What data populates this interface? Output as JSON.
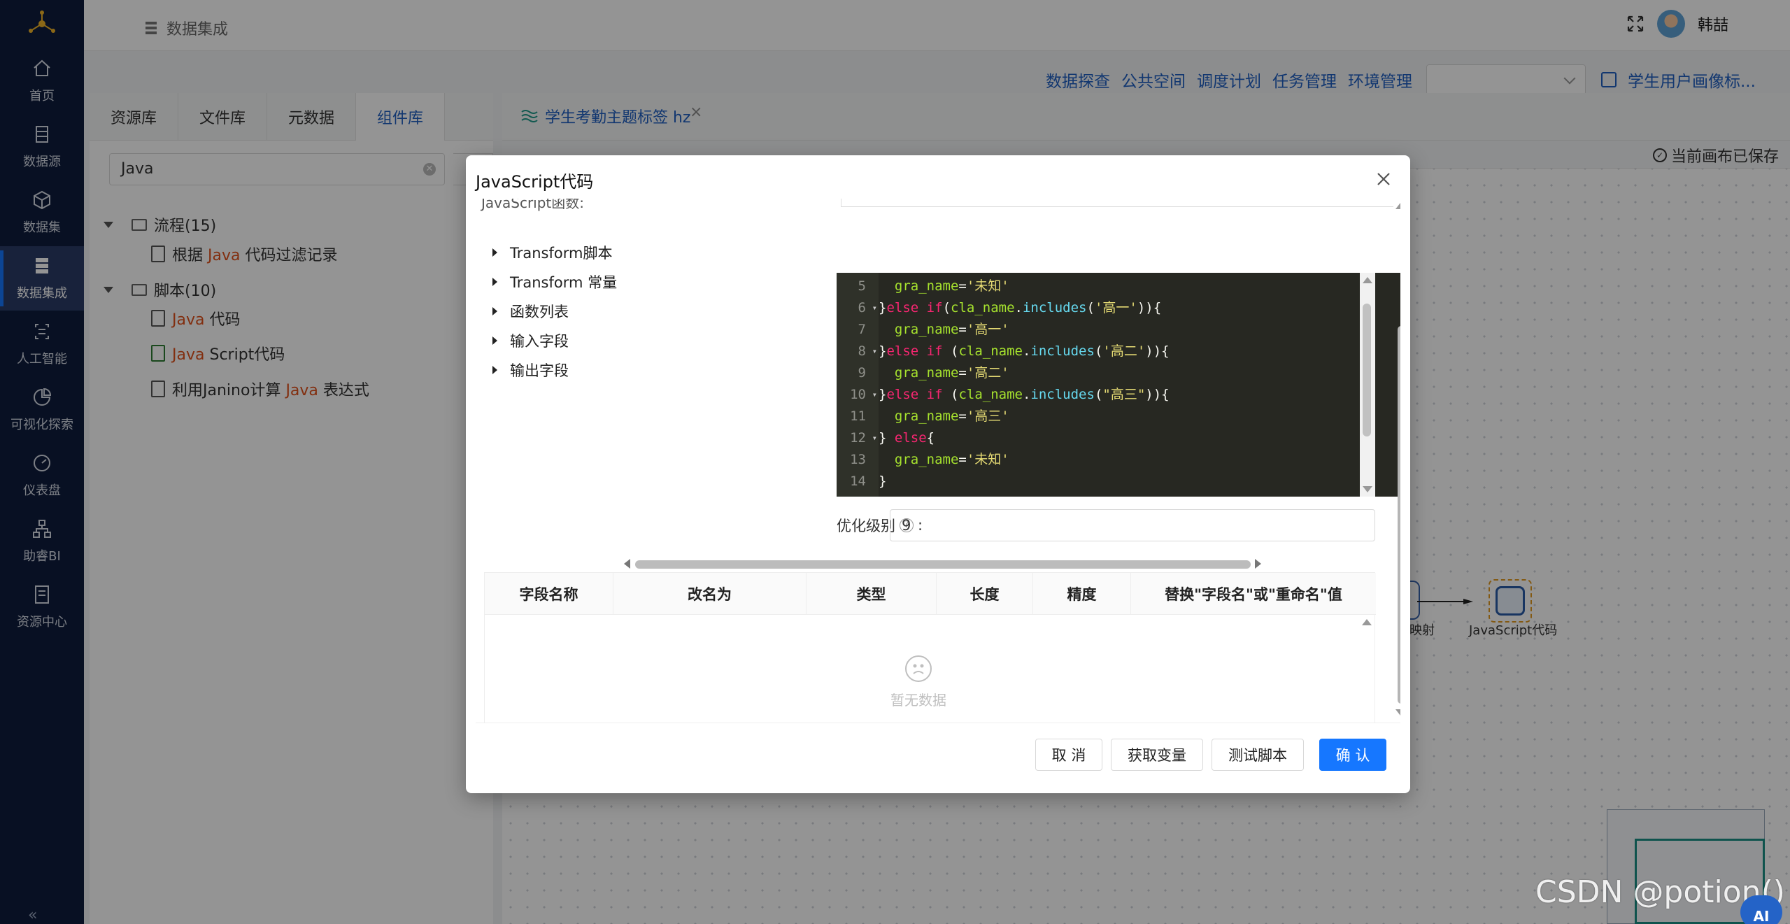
{
  "sidebar": {
    "items": [
      {
        "label": "首页",
        "icon": "home-icon"
      },
      {
        "label": "数据源",
        "icon": "database-icon"
      },
      {
        "label": "数据集",
        "icon": "cube-icon"
      },
      {
        "label": "数据集成",
        "icon": "integration-icon",
        "active": true
      },
      {
        "label": "人工智能",
        "icon": "ai-icon"
      },
      {
        "label": "可视化探索",
        "icon": "pie-chart-icon"
      },
      {
        "label": "仪表盘",
        "icon": "gauge-icon"
      },
      {
        "label": "助睿BI",
        "icon": "org-chart-icon"
      },
      {
        "label": "资源中心",
        "icon": "resource-icon"
      }
    ],
    "collapse_label": "«"
  },
  "header": {
    "breadcrumb": "数据集成",
    "username": "韩喆"
  },
  "toplinks": [
    "数据探查",
    "公共空间",
    "调度计划",
    "任务管理",
    "环境管理"
  ],
  "toplink_select_value": "",
  "toplink_last": "学生用户画像标...",
  "left_panel": {
    "tabs": [
      "资源库",
      "文件库",
      "元数据",
      "组件库"
    ],
    "active_tab": "组件库",
    "search_value": "Java",
    "tree": {
      "group1": {
        "label": "流程(15)",
        "children": [
          {
            "before": "根据 ",
            "kw": "Java",
            "after": " 代码过滤记录"
          }
        ]
      },
      "group2": {
        "label": "脚本(10)",
        "children": [
          {
            "before": "",
            "kw": "Java",
            "after": " 代码"
          },
          {
            "before": "",
            "kw": "Java",
            "after": " Script代码"
          },
          {
            "before": "利用Janino计算 ",
            "kw": "Java",
            "after": " 表达式"
          }
        ]
      }
    }
  },
  "canvas": {
    "tab_label": "学生考勤主题标签 hz",
    "tab_close": "×",
    "saved_text": "当前画布已保存",
    "node_map_label": "映射",
    "node_js_label": "JavaScript代码"
  },
  "modal": {
    "title": "JavaScript代码",
    "cut_text": "JavaScript函数:",
    "tree_items": [
      "Transform脚本",
      "Transform 常量",
      "函数列表",
      "输入字段",
      "输出字段"
    ],
    "code_lines": [
      {
        "n": "5",
        "fold": "",
        "text": "  gra_name='未知'"
      },
      {
        "n": "6",
        "fold": "▾",
        "text": "}else if(cla_name.includes('高一')){"
      },
      {
        "n": "7",
        "fold": "",
        "text": "  gra_name='高一'"
      },
      {
        "n": "8",
        "fold": "▾",
        "text": "}else if (cla_name.includes('高二')){"
      },
      {
        "n": "9",
        "fold": "",
        "text": "  gra_name='高二'"
      },
      {
        "n": "10",
        "fold": "▾",
        "text": "}else if (cla_name.includes(\"高三\")){"
      },
      {
        "n": "11",
        "fold": "",
        "text": "  gra_name='高三'"
      },
      {
        "n": "12",
        "fold": "▾",
        "text": "} else{"
      },
      {
        "n": "13",
        "fold": "",
        "text": "  gra_name='未知'"
      },
      {
        "n": "14",
        "fold": "",
        "text": "}"
      }
    ],
    "opt_label": "优化级别",
    "opt_value": "9",
    "table_headers": [
      "字段名称",
      "改名为",
      "类型",
      "长度",
      "精度",
      "替换\"字段名\"或\"重命名\"值"
    ],
    "empty_text": "暂无数据",
    "buttons": {
      "cancel": "取 消",
      "get_vars": "获取变量",
      "test": "测试脚本",
      "ok": "确 认"
    }
  },
  "watermark": "CSDN @potion()",
  "ai_badge": "AI"
}
